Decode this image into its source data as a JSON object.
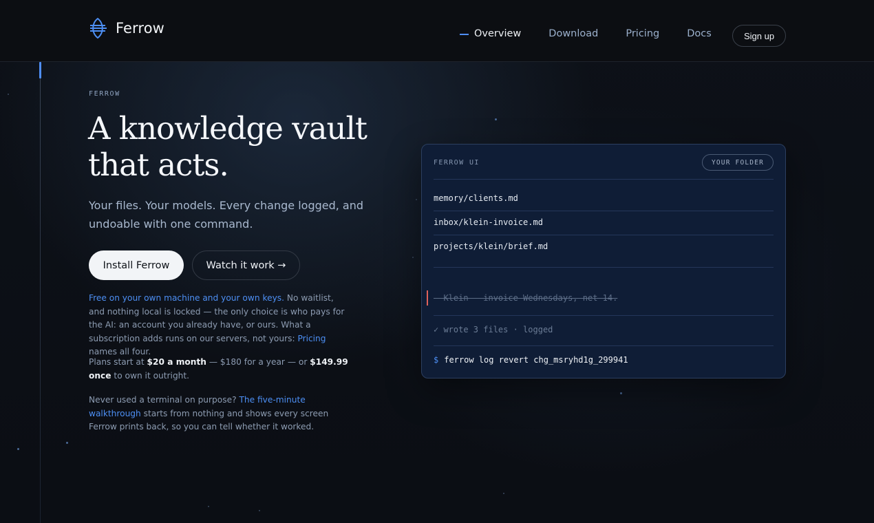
{
  "nav": {
    "brand": "Ferrow",
    "links": [
      {
        "label": "Overview",
        "active": true
      },
      {
        "label": "Download",
        "active": false
      },
      {
        "label": "Pricing",
        "active": false
      },
      {
        "label": "Docs",
        "active": false
      }
    ],
    "signup_label": "Sign up"
  },
  "hero": {
    "eyebrow": "FERROW",
    "headline_line1": "A knowledge vault",
    "headline_line2": "that acts.",
    "subtitle": "Your files. Your models. Every change logged, and undoable with one command.",
    "install_label": "Install Ferrow",
    "watch_label": "Watch it work →"
  },
  "details": {
    "free_link": "Free on your own machine and your own keys.",
    "free_rest": " No waitlist, and nothing local is locked — the only choice is who pays for the AI: an account you already have, or ours. What a subscription adds runs on our servers, not yours: ",
    "pricing_link": "Pricing",
    "free_end": " names all four.",
    "plans_start": "Plans start at ",
    "plans_month": "$20 a month",
    "plans_mid": " — $180 for a year — or ",
    "plans_once": "$149.99 once",
    "plans_end": " to own it outright.",
    "terminal_q": "Never used a terminal on purpose? ",
    "walkthrough_link": "The five-minute walkthrough",
    "terminal_rest": " starts from nothing and shows every screen Ferrow prints back, so you can tell whether it worked."
  },
  "terminal": {
    "title": "FERROW UI",
    "badge": "YOUR FOLDER",
    "files": [
      "memory/clients.md",
      "inbox/klein-invoice.md",
      "projects/klein/brief.md"
    ],
    "struck_line": "– Klein — invoice Wednesdays, net 14.",
    "logged_line": "✓ wrote 3 files · logged",
    "prompt": "$",
    "command": "ferrow log revert chg_msryhd1g_299941"
  },
  "colors": {
    "accent": "#4d8ff4",
    "background": "#0b0e14",
    "card": "#0f1d36",
    "strike_marker": "#e0625a"
  }
}
